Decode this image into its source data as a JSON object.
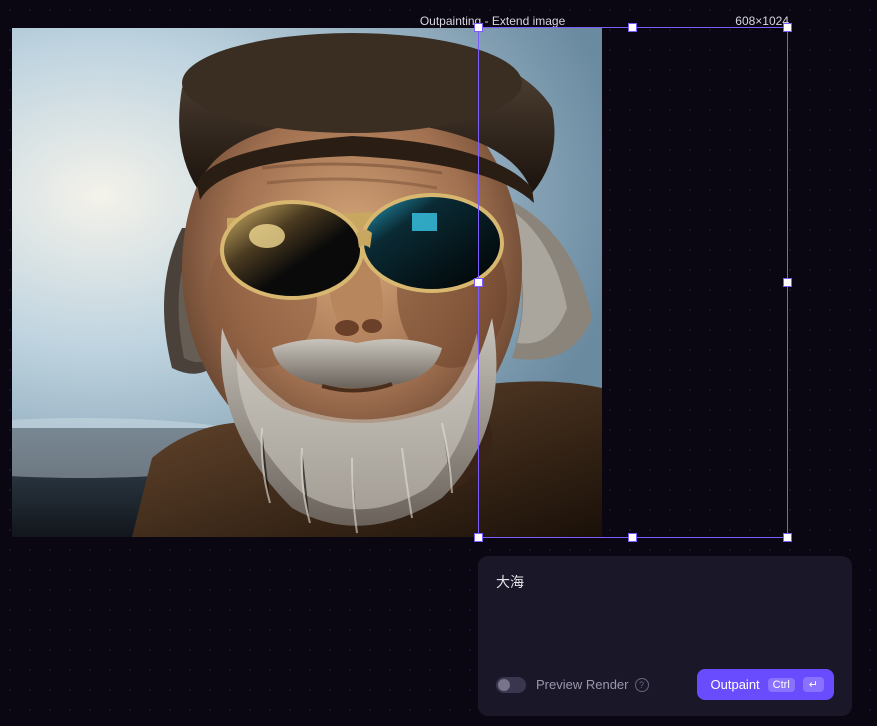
{
  "header": {
    "tool_label": "Outpainting - Extend image",
    "dimensions": "608×1024"
  },
  "prompt_value": "大海",
  "preview": {
    "label": "Preview Render",
    "enabled": false
  },
  "outpaint": {
    "label": "Outpaint",
    "shortcut_key": "Ctrl",
    "shortcut_enter": "↵"
  },
  "colors": {
    "accent": "#6a4cff",
    "selection": "#7b5cff"
  }
}
